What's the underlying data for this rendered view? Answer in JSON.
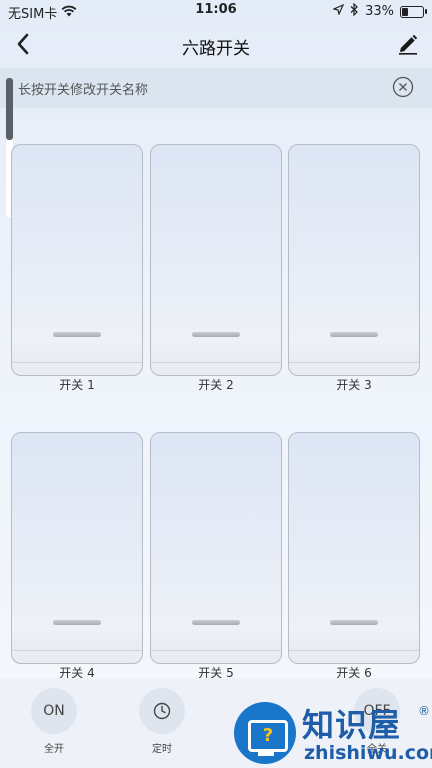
{
  "status_bar": {
    "carrier": "无SIM卡",
    "time": "11:06",
    "battery_percent": "33%",
    "battery_level": 0.33,
    "icons": [
      "wifi-icon",
      "location-icon",
      "bluetooth-icon",
      "battery-icon"
    ]
  },
  "nav": {
    "title": "六路开关",
    "back_icon": "chevron-left-icon",
    "edit_icon": "pencil-icon"
  },
  "tip": {
    "text": "长按开关修改开关名称",
    "close_icon": "close-circle-icon"
  },
  "scroll": {
    "position": 0.0
  },
  "switches": [
    {
      "label": "开关 1"
    },
    {
      "label": "开关 2"
    },
    {
      "label": "开关 3"
    },
    {
      "label": "开关 4"
    },
    {
      "label": "开关 5"
    },
    {
      "label": "开关 6"
    }
  ],
  "bottom_bar": {
    "all_on": {
      "icon_text": "ON",
      "label": "全开"
    },
    "timer": {
      "icon": "clock-icon",
      "label": "定时"
    },
    "all_off": {
      "icon_text": "OFF",
      "label": "全关"
    }
  },
  "watermark": {
    "cn": "知识屋",
    "reg": "®",
    "en": "zhishiwu.com",
    "icon_char": "?"
  },
  "colors": {
    "watermark_blue": "#1e5da8",
    "watermark_icon": "#1976c8",
    "scroll_thumb": "#5c5f66"
  }
}
